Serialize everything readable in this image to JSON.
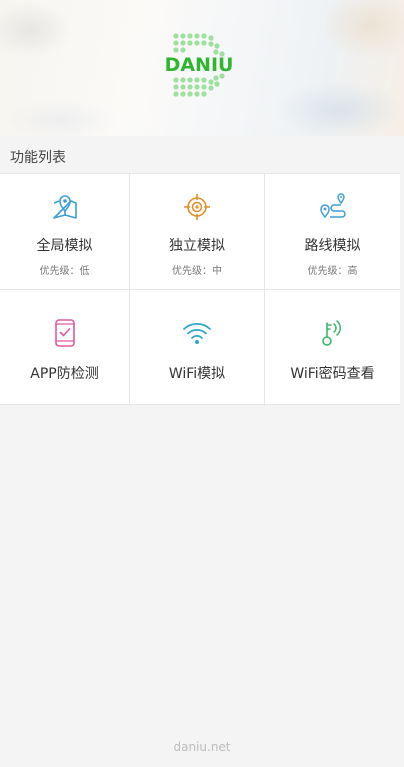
{
  "header": {
    "logo_text": "DANIU"
  },
  "section": {
    "title": "功能列表"
  },
  "features": [
    {
      "label": "全局模拟",
      "sub": "优先级：低",
      "icon": "map-pin-icon",
      "color": "#3a9fd8"
    },
    {
      "label": "独立模拟",
      "sub": "优先级：中",
      "icon": "target-crosshair-icon",
      "color": "#e0902a"
    },
    {
      "label": "路线模拟",
      "sub": "优先级：高",
      "icon": "route-icon",
      "color": "#3a9fd8"
    },
    {
      "label": "APP防检测",
      "sub": "",
      "icon": "phone-check-icon",
      "color": "#e05aa0"
    },
    {
      "label": "WiFi模拟",
      "sub": "",
      "icon": "wifi-icon",
      "color": "#28a8c8"
    },
    {
      "label": "WiFi密码查看",
      "sub": "",
      "icon": "key-signal-icon",
      "color": "#3ab86a"
    }
  ],
  "footer": {
    "text": "daniu.net"
  },
  "colors": {
    "brand_green": "#3cc03c",
    "background": "#f4f4f4"
  }
}
